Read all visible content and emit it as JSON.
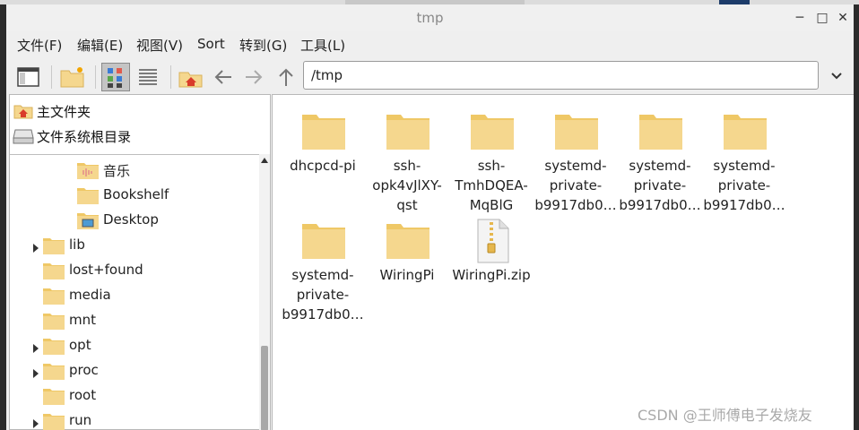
{
  "window": {
    "title": "tmp",
    "controls": {
      "minimize": "─",
      "maximize": "□",
      "close": "✕"
    }
  },
  "menu": [
    "文件(F)",
    "编辑(E)",
    "视图(V)",
    "Sort",
    "转到(G)",
    "工具(L)"
  ],
  "toolbar": {
    "buttons": [
      "new-window-icon",
      "new-folder-icon",
      "icon-view-icon",
      "list-view-icon",
      "home-icon",
      "back-icon",
      "forward-icon",
      "up-icon"
    ],
    "address": "/tmp"
  },
  "places": [
    "主文件夹",
    "文件系统根目录"
  ],
  "tree": [
    {
      "label": "音乐",
      "level": 2,
      "expandable": false,
      "icon": "music-folder"
    },
    {
      "label": "Bookshelf",
      "level": 2,
      "expandable": false,
      "icon": "folder"
    },
    {
      "label": "Desktop",
      "level": 2,
      "expandable": false,
      "icon": "desktop-folder"
    },
    {
      "label": "lib",
      "level": 1,
      "expandable": true,
      "icon": "folder"
    },
    {
      "label": "lost+found",
      "level": 1,
      "expandable": false,
      "icon": "folder"
    },
    {
      "label": "media",
      "level": 1,
      "expandable": false,
      "icon": "folder"
    },
    {
      "label": "mnt",
      "level": 1,
      "expandable": false,
      "icon": "folder"
    },
    {
      "label": "opt",
      "level": 1,
      "expandable": true,
      "icon": "folder"
    },
    {
      "label": "proc",
      "level": 1,
      "expandable": true,
      "icon": "folder"
    },
    {
      "label": "root",
      "level": 1,
      "expandable": false,
      "icon": "folder"
    },
    {
      "label": "run",
      "level": 1,
      "expandable": true,
      "icon": "folder"
    }
  ],
  "files": [
    {
      "lines": [
        "dhcpcd-pi"
      ],
      "type": "folder"
    },
    {
      "lines": [
        "ssh-",
        "opk4vJlXY-",
        "qst"
      ],
      "type": "folder"
    },
    {
      "lines": [
        "ssh-",
        "TmhDQEA-",
        "MqBlG"
      ],
      "type": "folder"
    },
    {
      "lines": [
        "systemd-",
        "private-",
        "b9917db0…"
      ],
      "type": "folder"
    },
    {
      "lines": [
        "systemd-",
        "private-",
        "b9917db0…"
      ],
      "type": "folder"
    },
    {
      "lines": [
        "systemd-",
        "private-",
        "b9917db0…"
      ],
      "type": "folder"
    },
    {
      "lines": [
        "systemd-",
        "private-",
        "b9917db0…"
      ],
      "type": "folder"
    },
    {
      "lines": [
        "WiringPi"
      ],
      "type": "folder"
    },
    {
      "lines": [
        "WiringPi.zip"
      ],
      "type": "zip"
    }
  ],
  "watermark": "CSDN @王师傅电子发烧友",
  "colors": {
    "folder": "#f5d78e",
    "folder_tab": "#efc866",
    "window_bg": "#efefef"
  }
}
